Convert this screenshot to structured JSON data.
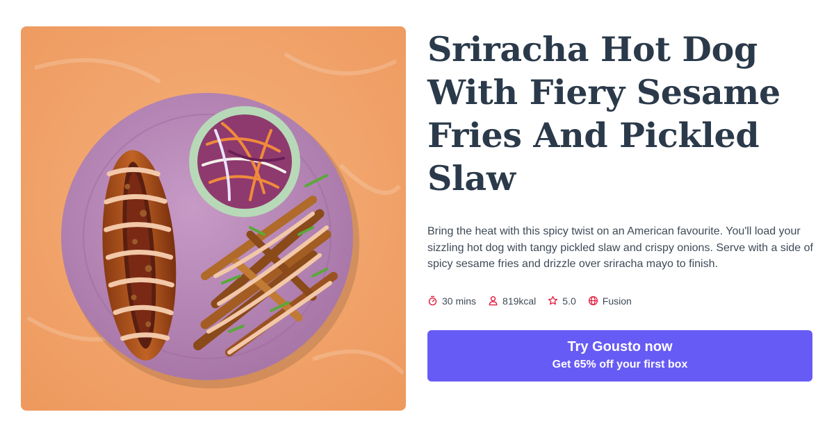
{
  "recipe": {
    "title": "Sriracha Hot Dog With Fiery Sesame Fries And Pickled Slaw",
    "description": "Bring the heat with this spicy twist on an American favourite. You'll load your sizzling hot dog with tangy pickled slaw and crispy onions. Serve with a side of spicy sesame fries and drizzle over sriracha mayo to finish.",
    "meta": {
      "time": "30 mins",
      "calories": "819kcal",
      "rating": "5.0",
      "cuisine": "Fusion"
    },
    "meta_icons": [
      "timer-icon",
      "person-icon",
      "star-icon",
      "globe-icon"
    ]
  },
  "cta": {
    "title": "Try Gousto now",
    "subtitle": "Get 65% off your first box"
  },
  "colors": {
    "accent": "#675bf5",
    "icon": "#e1193c",
    "heading": "#2b3a4a",
    "background_photo": "#f1a06a",
    "plate": "#b586b5"
  }
}
